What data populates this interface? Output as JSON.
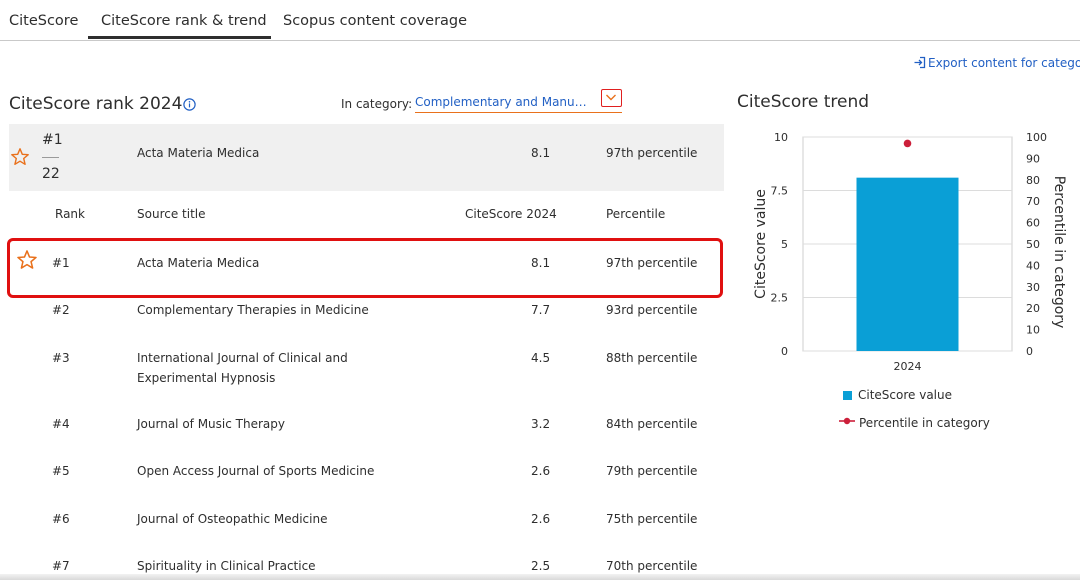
{
  "tabs": [
    "CiteScore",
    "CiteScore rank & trend",
    "Scopus content coverage"
  ],
  "active_tab_index": 1,
  "export_label": "Export content for category",
  "rank": {
    "heading": "CiteScore rank 2024",
    "category_label": "In category:",
    "category_value": "Complementary and Manual Therapy",
    "summary": {
      "rank": "#1",
      "total": "22",
      "title": "Acta Materia Medica",
      "score": "8.1",
      "percentile": "97th percentile"
    },
    "columns": {
      "rank": "Rank",
      "title": "Source title",
      "score": "CiteScore 2024",
      "percentile": "Percentile"
    },
    "rows": [
      {
        "rank": "#1",
        "title": "Acta Materia Medica",
        "score": "8.1",
        "percentile": "97th percentile",
        "starred": true
      },
      {
        "rank": "#2",
        "title": "Complementary Therapies in Medicine",
        "score": "7.7",
        "percentile": "93rd percentile"
      },
      {
        "rank": "#3",
        "title": "International Journal of Clinical and Experimental Hypnosis",
        "score": "4.5",
        "percentile": "88th percentile"
      },
      {
        "rank": "#4",
        "title": "Journal of Music Therapy",
        "score": "3.2",
        "percentile": "84th percentile"
      },
      {
        "rank": "#5",
        "title": "Open Access Journal of Sports Medicine",
        "score": "2.6",
        "percentile": "79th percentile"
      },
      {
        "rank": "#6",
        "title": "Journal of Osteopathic Medicine",
        "score": "2.6",
        "percentile": "75th percentile"
      },
      {
        "rank": "#7",
        "title": "Spirituality in Clinical Practice",
        "score": "2.5",
        "percentile": "70th percentile"
      }
    ]
  },
  "trend": {
    "heading": "CiteScore trend",
    "legend_citescore": "CiteScore value",
    "legend_percentile": "Percentile in category"
  },
  "colors": {
    "accent_orange": "#e9711c",
    "link_blue": "#2260c4",
    "bar_blue": "#0a9fd6",
    "percentile_red": "#cc1f3a",
    "highlight_red": "#e01010"
  },
  "chart_data": {
    "type": "bar",
    "categories": [
      "2024"
    ],
    "series": [
      {
        "name": "CiteScore value",
        "values": [
          8.1
        ],
        "axis": "left"
      },
      {
        "name": "Percentile in category",
        "values": [
          97
        ],
        "axis": "right",
        "marker": "dot"
      }
    ],
    "ylabel": "CiteScore value",
    "ylim": [
      0,
      10
    ],
    "yticks": [
      "0",
      "2.5",
      "5",
      "7.5",
      "10"
    ],
    "y2label": "Percentile in category",
    "y2lim": [
      0,
      100
    ],
    "y2ticks": [
      "0",
      "10",
      "20",
      "30",
      "40",
      "50",
      "60",
      "70",
      "80",
      "90",
      "100"
    ],
    "grid": true,
    "legend": "bottom"
  }
}
